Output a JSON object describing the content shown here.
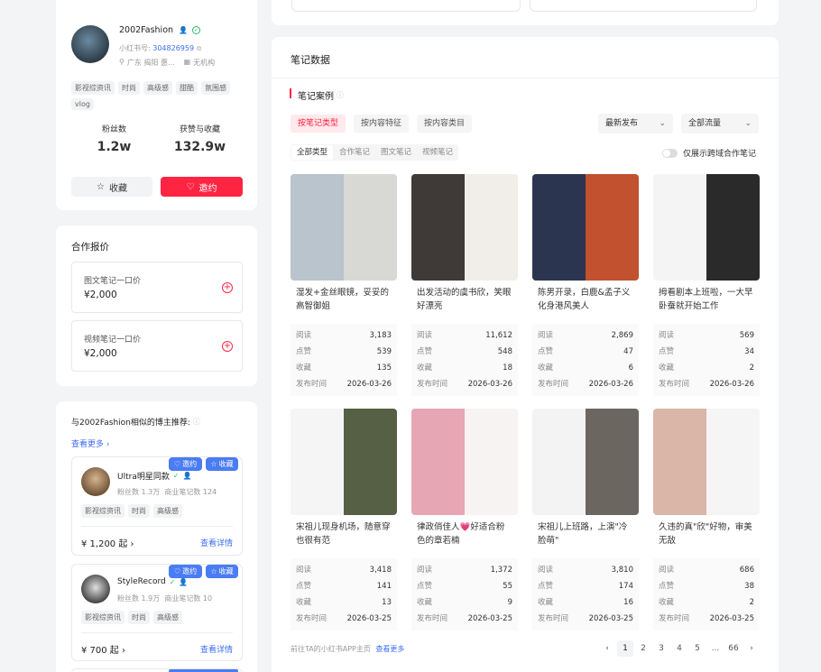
{
  "profile": {
    "name": "2002Fashion",
    "rednote_label": "小红书号:",
    "rednote_id": "304826959",
    "location": "广东 揭阳 惠...",
    "org": "无机构",
    "tags": [
      "影视综资讯",
      "时尚",
      "高级感",
      "甜酷",
      "氛围感",
      "vlog"
    ],
    "fans_label": "粉丝数",
    "fans_value": "1.2w",
    "likes_label": "获赞与收藏",
    "likes_value": "132.9w",
    "collect_label": "收藏",
    "invite_label": "邀约"
  },
  "pricing": {
    "title": "合作报价",
    "items": [
      {
        "label": "图文笔记一口价",
        "price": "¥2,000"
      },
      {
        "label": "视频笔记一口价",
        "price": "¥2,000"
      }
    ]
  },
  "similar": {
    "title": "与2002Fashion相似的博主推荐:",
    "more": "查看更多 ›",
    "invite_label": "邀约",
    "collect_label": "收藏",
    "detail_label": "查看详情",
    "bloggers": [
      {
        "name": "Ultra明星同款",
        "fans": "粉丝数 1.3万",
        "notes": "商业笔记数 124",
        "tags": [
          "影视综资讯",
          "时尚",
          "高级感"
        ],
        "price": "¥ 1,200 起 ›"
      },
      {
        "name": "StyleRecord",
        "fans": "粉丝数 1.9万",
        "notes": "商业笔记数 10",
        "tags": [
          "影视综资讯",
          "时尚",
          "高级感"
        ],
        "price": "¥ 700 起 ›"
      }
    ]
  },
  "notes_section": {
    "header": "笔记数据",
    "subheader": "笔记案例",
    "tabs": [
      "按笔记类型",
      "按内容特征",
      "按内容类目"
    ],
    "sort_select": "最新发布",
    "traffic_select": "全部流量",
    "type_filters": [
      "全部类型",
      "合作笔记",
      "图文笔记",
      "视频笔记"
    ],
    "toggle_label": "仅展示跨域合作笔记",
    "stat_labels": [
      "阅读",
      "点赞",
      "收藏",
      "发布时间"
    ],
    "notes": [
      {
        "title": "湿发+金丝眼镜，妥妥的高智御姐",
        "read": "3,183",
        "like": "539",
        "fav": "135",
        "date": "2026-03-26",
        "c1": "#b9c4cc",
        "c2": "#d8d9d4"
      },
      {
        "title": "出发活动的虞书欣，笑眼好漂亮",
        "read": "11,612",
        "like": "548",
        "fav": "18",
        "date": "2026-03-26",
        "c1": "#3f3a37",
        "c2": "#f1eeea"
      },
      {
        "title": "陈男开录，白鹿&孟子义化身港风美人",
        "read": "2,869",
        "like": "47",
        "fav": "6",
        "date": "2026-03-26",
        "c1": "#2b3550",
        "c2": "#c1512f"
      },
      {
        "title": "拇看剧本上班啦，一大早卧蚕就开始工作",
        "read": "569",
        "like": "34",
        "fav": "2",
        "date": "2026-03-26",
        "c1": "#f4f4f4",
        "c2": "#2a2a2a"
      },
      {
        "title": "宋祖儿现身机场，随意穿也很有范",
        "read": "3,418",
        "like": "141",
        "fav": "13",
        "date": "2026-03-25",
        "c1": "#f5f5f5",
        "c2": "#556044"
      },
      {
        "title": "律政俏佳人💗好适合粉色的章若楠",
        "read": "1,372",
        "like": "55",
        "fav": "9",
        "date": "2026-03-25",
        "c1": "#e7a6b3",
        "c2": "#f7f3f3"
      },
      {
        "title": "宋祖儿上班路，上演\"冷脸萌\"",
        "read": "3,810",
        "like": "174",
        "fav": "16",
        "date": "2026-03-25",
        "c1": "#f3f3f3",
        "c2": "#6b6660"
      },
      {
        "title": "久违的真\"欣\"好物，审美无敌",
        "read": "686",
        "like": "38",
        "fav": "2",
        "date": "2026-03-25",
        "c1": "#d9b6a8",
        "c2": "#f5f5f5"
      }
    ],
    "footer_text": "前往TA的小红书APP主页",
    "footer_link": "查看更多",
    "pager": [
      "‹",
      "1",
      "2",
      "3",
      "4",
      "5",
      "...",
      "66",
      "›"
    ]
  },
  "colors": {
    "accent": "#ff2442",
    "link": "#3d6df2",
    "badge": "#4a7cf3"
  }
}
